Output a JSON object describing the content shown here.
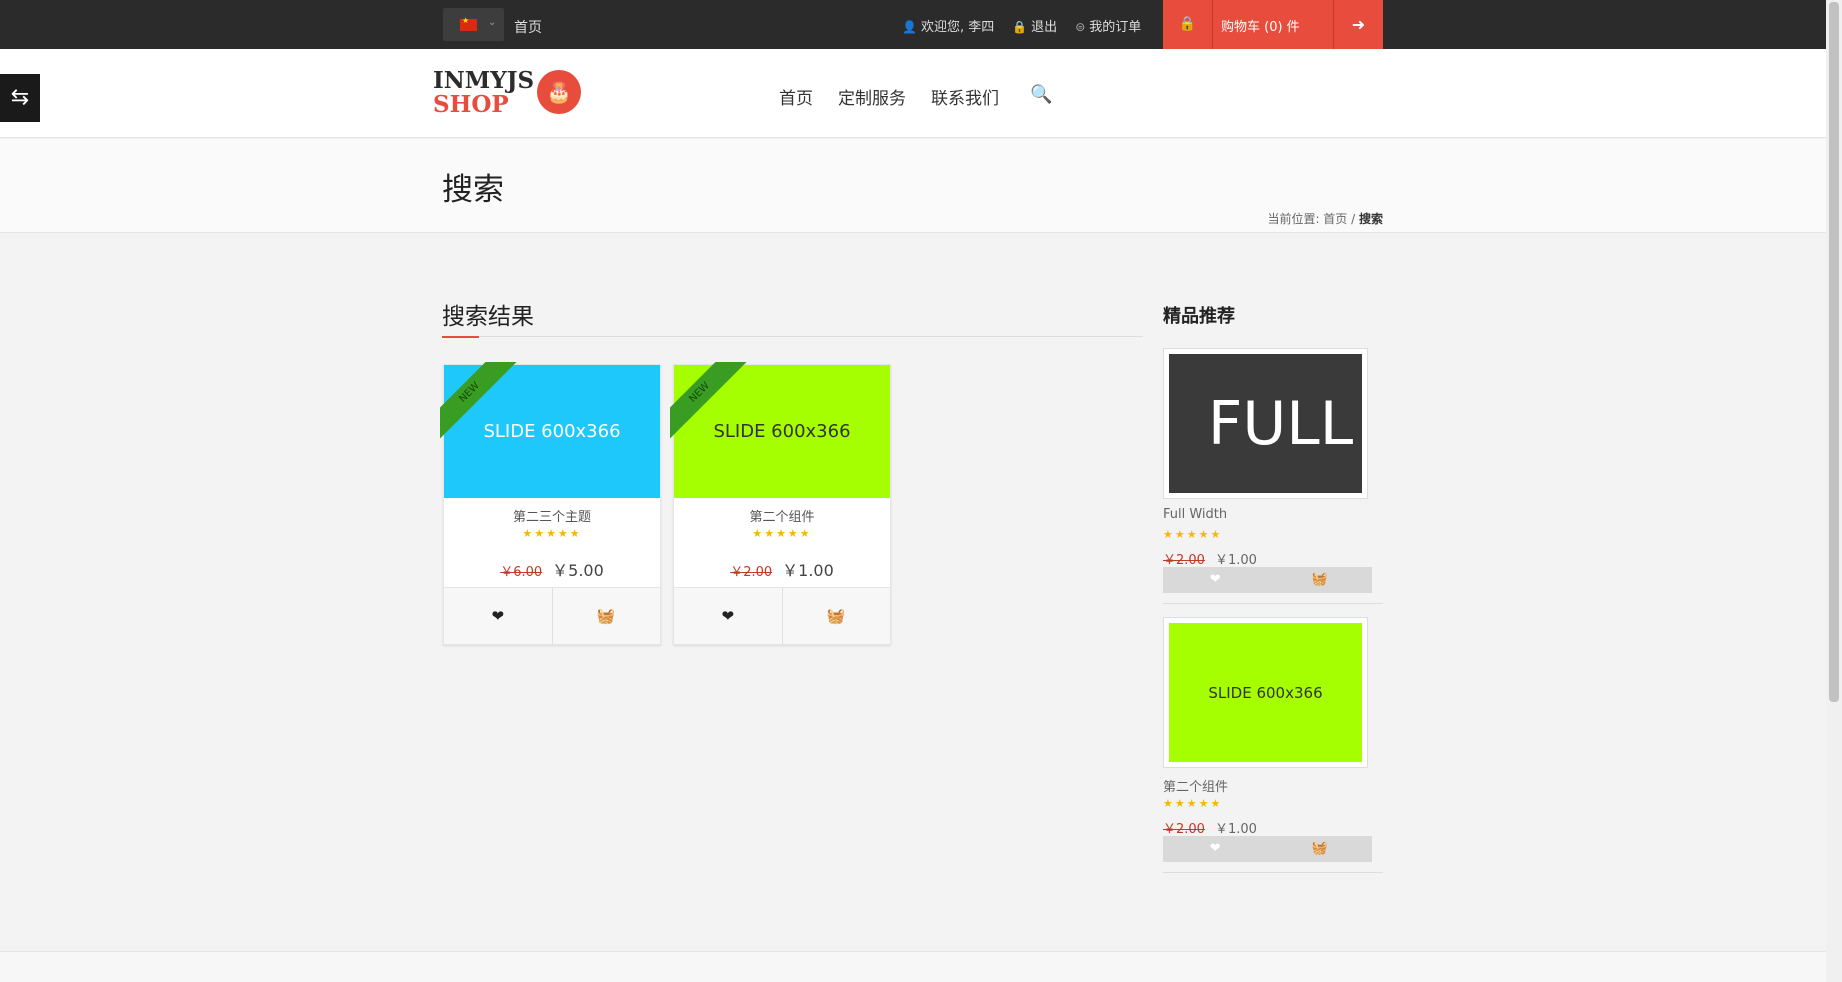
{
  "topbar": {
    "home": "首页",
    "welcome": "欢迎您, 李四",
    "logout": "退出",
    "orders": "我的订单",
    "cart": "购物车 (0) 件"
  },
  "header": {
    "logo_line1": "INMYJS",
    "logo_line2": "SHOP",
    "nav": [
      "首页",
      "定制服务",
      "联系我们"
    ]
  },
  "page": {
    "title": "搜索",
    "breadcrumb_prefix": "当前位置: ",
    "breadcrumb_home": "首页",
    "breadcrumb_sep": " / ",
    "breadcrumb_current": "搜索"
  },
  "results": {
    "title": "搜索结果",
    "items": [
      {
        "ribbon": "NEW",
        "image_text": "SLIDE  600x366",
        "image_color": "#1ec8fa",
        "name": "第二三个主题",
        "stars": "★★★★★",
        "old_price": "￥6.00",
        "price": "￥5.00"
      },
      {
        "ribbon": "NEW",
        "image_text": "SLIDE  600x366",
        "image_color": "#a6ff00",
        "name": "第二个组件",
        "stars": "★★★★★",
        "old_price": "￥2.00",
        "price": "￥1.00"
      }
    ]
  },
  "sidebar": {
    "title": "精品推荐",
    "items": [
      {
        "image_text": "FULL",
        "image_color": "#3a3a3a",
        "name": "Full Width",
        "stars": "★★★★★",
        "old_price": "￥2.00",
        "price": "￥1.00"
      },
      {
        "image_text": "SLIDE  600x366",
        "image_color": "#a6ff00",
        "name": "第二个组件",
        "stars": "★★★★★",
        "old_price": "￥2.00",
        "price": "￥1.00"
      }
    ]
  },
  "icons": {
    "heart": "❤",
    "basket": "🧺",
    "lock": "🔒",
    "arrow": "➜",
    "search": "🔍",
    "user": "👤",
    "toggle": "⇆"
  }
}
